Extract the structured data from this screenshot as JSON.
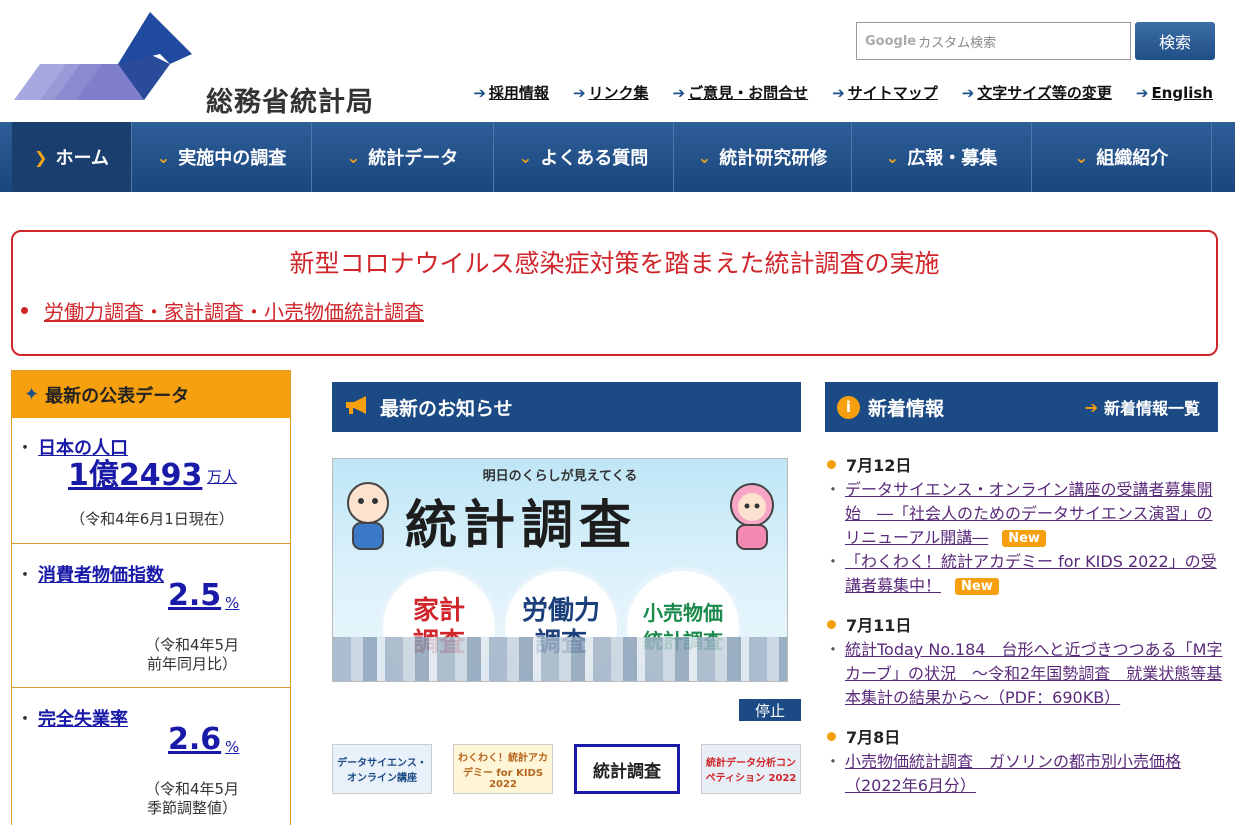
{
  "site": {
    "name": "総務省統計局"
  },
  "search": {
    "placeholder": "カスタム検索",
    "google_label": "Google",
    "button": "検索"
  },
  "util_nav": [
    {
      "label": "採用情報"
    },
    {
      "label": "リンク集"
    },
    {
      "label": "ご意見・お問合せ"
    },
    {
      "label": "サイトマップ"
    },
    {
      "label": "文字サイズ等の変更"
    },
    {
      "label": "English"
    }
  ],
  "main_nav": [
    {
      "label": "ホーム",
      "active": true
    },
    {
      "label": "実施中の調査"
    },
    {
      "label": "統計データ"
    },
    {
      "label": "よくある質問"
    },
    {
      "label": "統計研究研修"
    },
    {
      "label": "広報・募集"
    },
    {
      "label": "組織紹介"
    }
  ],
  "alert": {
    "title": "新型コロナウイルス感染症対策を踏まえた統計調査の実施",
    "link": "労働力調査・家計調査・小売物価統計調査"
  },
  "latest_data": {
    "title": "最新の公表データ",
    "items": [
      {
        "title": "日本の人口",
        "value": "1億2493",
        "unit": "万人",
        "note": "（令和4年6月1日現在）"
      },
      {
        "title": "消費者物価指数",
        "value": "2.5",
        "unit": "%",
        "note_lines": [
          "（令和4年5月",
          "前年同月比）"
        ]
      },
      {
        "title": "完全失業率",
        "value": "2.6",
        "unit": "%",
        "note_lines": [
          "（令和4年5月",
          "季節調整値）"
        ]
      }
    ]
  },
  "news": {
    "title": "最新のお知らせ",
    "banner": {
      "top": "明日のくらしが見えてくる",
      "title": "統計調査",
      "circles": [
        {
          "line1": "家計",
          "line2": "調査",
          "color": "#d0262b"
        },
        {
          "line1": "労働力",
          "line2": "調査",
          "color": "#1b3f7a"
        },
        {
          "line1": "小売物価",
          "line2": "統計調査",
          "color": "#1a8a4a"
        }
      ]
    },
    "stop_button": "停止",
    "thumbs": [
      {
        "text": "データサイエンス・オンライン講座",
        "bg": "#e8f0fa"
      },
      {
        "text": "わくわく！統計アカデミー for KIDS 2022",
        "bg": "#fff6d8"
      },
      {
        "text": "統計調査",
        "bg": "#ffffff"
      },
      {
        "text": "統計データ分析コンペティション 2022",
        "bg": "#e7eef5"
      }
    ]
  },
  "info": {
    "title": "新着情報",
    "more": "新着情報一覧",
    "days": [
      {
        "date": "7月12日",
        "entries": [
          {
            "text": "データサイエンス・オンライン講座の受講者募集開始　―「社会人のためのデータサイエンス演習」のリニューアル開講―",
            "badge": "New"
          },
          {
            "text": "「わくわく！統計アカデミー for KIDS 2022」の受講者募集中！",
            "badge": "New"
          }
        ]
      },
      {
        "date": "7月11日",
        "entries": [
          {
            "text": "統計Today No.184　台形へと近づきつつある「M字カーブ」の状況　～令和2年国勢調査　就業状態等基本集計の結果から～（PDF：690KB）"
          }
        ]
      },
      {
        "date": "7月8日",
        "entries": [
          {
            "text": "小売物価統計調査　ガソリンの都市別小売価格（2022年6月分）"
          }
        ]
      }
    ]
  },
  "colors": {
    "brand_blue": "#1b4a84",
    "accent_orange": "#f6a010",
    "alert_red": "#d0262b",
    "link_blue": "#1a1aa8"
  }
}
